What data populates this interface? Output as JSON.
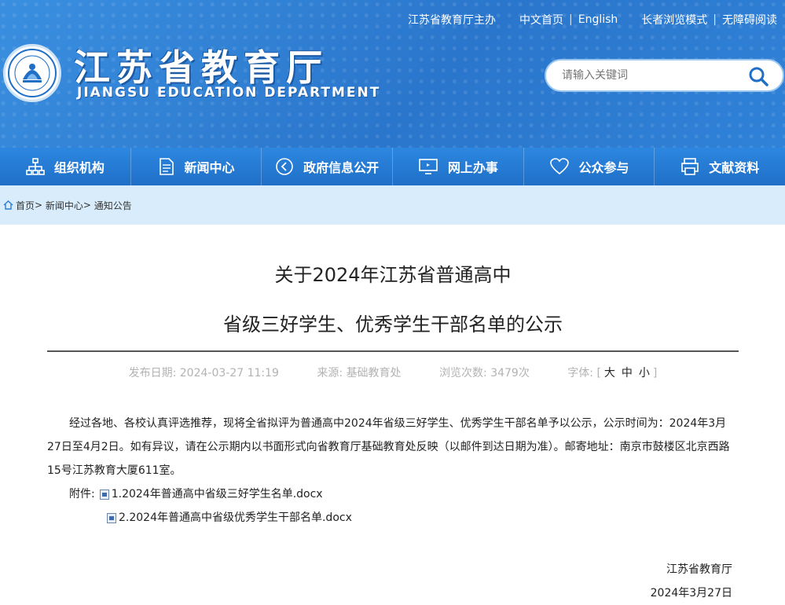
{
  "header": {
    "top_links": [
      "江苏省教育厅主办",
      "中文首页",
      "English",
      "长者浏览模式",
      "无障碍阅读"
    ],
    "title": "江苏省教育厅",
    "subtitle": "JIANGSU EDUCATION DEPARTMENT",
    "search_placeholder": "请输入关键词"
  },
  "nav": {
    "items": [
      {
        "label": "组织机构",
        "icon": "org-chart-icon"
      },
      {
        "label": "新闻中心",
        "icon": "document-icon"
      },
      {
        "label": "政府信息公开",
        "icon": "eye-icon"
      },
      {
        "label": "网上办事",
        "icon": "monitor-icon"
      },
      {
        "label": "公众参与",
        "icon": "heart-icon"
      },
      {
        "label": "文献资料",
        "icon": "printer-icon"
      }
    ]
  },
  "breadcrumb": [
    "首页",
    "新闻中心",
    "通知公告"
  ],
  "article": {
    "title_line1": "关于2024年江苏省普通高中",
    "title_line2": "省级三好学生、优秀学生干部名单的公示",
    "publish_label": "发布日期:",
    "publish_date": "2024-03-27 11:19",
    "source_label": "来源:",
    "source": "基础教育处",
    "views_label": "浏览次数:",
    "views": "3479次",
    "font_label": "字体:",
    "font_sizes": [
      "大",
      "中",
      "小"
    ],
    "body": "经过各地、各校认真评选推荐，现将全省拟评为普通高中2024年省级三好学生、优秀学生干部名单予以公示，公示时间为：2024年3月27日至4月2日。如有异议，请在公示期内以书面形式向省教育厅基础教育处反映（以邮件到达日期为准）。邮寄地址：南京市鼓楼区北京西路15号江苏教育大厦611室。",
    "attachment_label": "附件:",
    "attachments": [
      "1.2024年普通高中省级三好学生名单.docx",
      "2.2024年普通高中省级优秀学生干部名单.docx"
    ],
    "signature": "江苏省教育厅",
    "sign_date": "2024年3月27日"
  },
  "colors": {
    "header_blue": "#2b7fd4",
    "nav_blue": "#1f6fc7",
    "crumb_bg": "#d9ecfb"
  }
}
